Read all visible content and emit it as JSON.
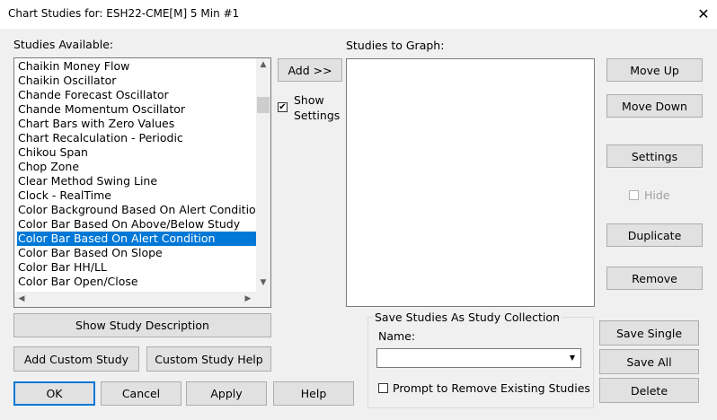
{
  "window": {
    "title": "Chart Studies for: ESH22-CME[M]  5 Min  #1",
    "close_glyph": "✕"
  },
  "studies_available": {
    "label": "Studies Available:",
    "items": [
      "Chaikin Money Flow",
      "Chaikin Oscillator",
      "Chande Forecast Oscillator",
      "Chande Momentum Oscillator",
      "Chart Bars with Zero Values",
      "Chart Recalculation - Periodic",
      "Chikou Span",
      "Chop Zone",
      "Clear Method Swing Line",
      "Clock - RealTime",
      "Color Background Based On Alert Condition",
      "Color Bar Based On Above/Below Study",
      "Color Bar Based On Alert Condition",
      "Color Bar Based On Slope",
      "Color Bar HH/LL",
      "Color Bar Open/Close"
    ],
    "selected": "Color Bar Based On Alert Condition"
  },
  "middle": {
    "add_label": "Add >>",
    "show_settings_label_1": "Show",
    "show_settings_label_2": "Settings",
    "show_settings_checked": true
  },
  "studies_to_graph": {
    "label": "Studies to Graph:"
  },
  "right_buttons": {
    "move_up": "Move Up",
    "move_down": "Move Down",
    "settings": "Settings",
    "hide": "Hide",
    "duplicate": "Duplicate",
    "remove": "Remove"
  },
  "left_buttons": {
    "show_desc": "Show Study Description",
    "add_custom": "Add Custom Study",
    "custom_help": "Custom Study Help"
  },
  "bottom_buttons": {
    "ok": "OK",
    "cancel": "Cancel",
    "apply": "Apply",
    "help": "Help"
  },
  "collection": {
    "legend": "Save Studies As Study Collection",
    "name_label": "Name:",
    "name_value": "",
    "prompt_label": "Prompt to Remove Existing Studies",
    "prompt_checked": false,
    "save_single": "Save Single",
    "save_all": "Save All",
    "delete": "Delete"
  },
  "icons": {
    "scroll_up": "▲",
    "scroll_down": "▼",
    "scroll_left": "◀",
    "scroll_right": "▶",
    "combo_arrow": "▼"
  }
}
